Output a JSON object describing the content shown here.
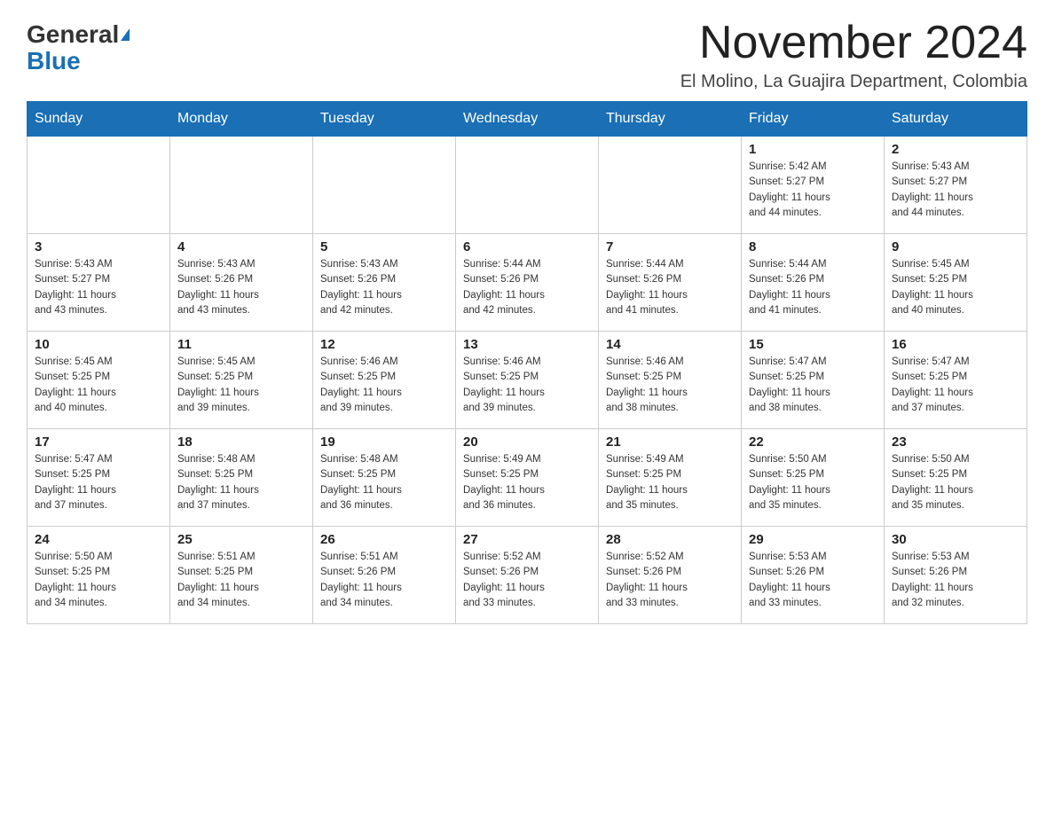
{
  "header": {
    "logo_general": "General",
    "logo_blue": "Blue",
    "month_title": "November 2024",
    "location": "El Molino, La Guajira Department, Colombia"
  },
  "weekdays": [
    "Sunday",
    "Monday",
    "Tuesday",
    "Wednesday",
    "Thursday",
    "Friday",
    "Saturday"
  ],
  "weeks": [
    [
      {
        "day": "",
        "info": ""
      },
      {
        "day": "",
        "info": ""
      },
      {
        "day": "",
        "info": ""
      },
      {
        "day": "",
        "info": ""
      },
      {
        "day": "",
        "info": ""
      },
      {
        "day": "1",
        "info": "Sunrise: 5:42 AM\nSunset: 5:27 PM\nDaylight: 11 hours\nand 44 minutes."
      },
      {
        "day": "2",
        "info": "Sunrise: 5:43 AM\nSunset: 5:27 PM\nDaylight: 11 hours\nand 44 minutes."
      }
    ],
    [
      {
        "day": "3",
        "info": "Sunrise: 5:43 AM\nSunset: 5:27 PM\nDaylight: 11 hours\nand 43 minutes."
      },
      {
        "day": "4",
        "info": "Sunrise: 5:43 AM\nSunset: 5:26 PM\nDaylight: 11 hours\nand 43 minutes."
      },
      {
        "day": "5",
        "info": "Sunrise: 5:43 AM\nSunset: 5:26 PM\nDaylight: 11 hours\nand 42 minutes."
      },
      {
        "day": "6",
        "info": "Sunrise: 5:44 AM\nSunset: 5:26 PM\nDaylight: 11 hours\nand 42 minutes."
      },
      {
        "day": "7",
        "info": "Sunrise: 5:44 AM\nSunset: 5:26 PM\nDaylight: 11 hours\nand 41 minutes."
      },
      {
        "day": "8",
        "info": "Sunrise: 5:44 AM\nSunset: 5:26 PM\nDaylight: 11 hours\nand 41 minutes."
      },
      {
        "day": "9",
        "info": "Sunrise: 5:45 AM\nSunset: 5:25 PM\nDaylight: 11 hours\nand 40 minutes."
      }
    ],
    [
      {
        "day": "10",
        "info": "Sunrise: 5:45 AM\nSunset: 5:25 PM\nDaylight: 11 hours\nand 40 minutes."
      },
      {
        "day": "11",
        "info": "Sunrise: 5:45 AM\nSunset: 5:25 PM\nDaylight: 11 hours\nand 39 minutes."
      },
      {
        "day": "12",
        "info": "Sunrise: 5:46 AM\nSunset: 5:25 PM\nDaylight: 11 hours\nand 39 minutes."
      },
      {
        "day": "13",
        "info": "Sunrise: 5:46 AM\nSunset: 5:25 PM\nDaylight: 11 hours\nand 39 minutes."
      },
      {
        "day": "14",
        "info": "Sunrise: 5:46 AM\nSunset: 5:25 PM\nDaylight: 11 hours\nand 38 minutes."
      },
      {
        "day": "15",
        "info": "Sunrise: 5:47 AM\nSunset: 5:25 PM\nDaylight: 11 hours\nand 38 minutes."
      },
      {
        "day": "16",
        "info": "Sunrise: 5:47 AM\nSunset: 5:25 PM\nDaylight: 11 hours\nand 37 minutes."
      }
    ],
    [
      {
        "day": "17",
        "info": "Sunrise: 5:47 AM\nSunset: 5:25 PM\nDaylight: 11 hours\nand 37 minutes."
      },
      {
        "day": "18",
        "info": "Sunrise: 5:48 AM\nSunset: 5:25 PM\nDaylight: 11 hours\nand 37 minutes."
      },
      {
        "day": "19",
        "info": "Sunrise: 5:48 AM\nSunset: 5:25 PM\nDaylight: 11 hours\nand 36 minutes."
      },
      {
        "day": "20",
        "info": "Sunrise: 5:49 AM\nSunset: 5:25 PM\nDaylight: 11 hours\nand 36 minutes."
      },
      {
        "day": "21",
        "info": "Sunrise: 5:49 AM\nSunset: 5:25 PM\nDaylight: 11 hours\nand 35 minutes."
      },
      {
        "day": "22",
        "info": "Sunrise: 5:50 AM\nSunset: 5:25 PM\nDaylight: 11 hours\nand 35 minutes."
      },
      {
        "day": "23",
        "info": "Sunrise: 5:50 AM\nSunset: 5:25 PM\nDaylight: 11 hours\nand 35 minutes."
      }
    ],
    [
      {
        "day": "24",
        "info": "Sunrise: 5:50 AM\nSunset: 5:25 PM\nDaylight: 11 hours\nand 34 minutes."
      },
      {
        "day": "25",
        "info": "Sunrise: 5:51 AM\nSunset: 5:25 PM\nDaylight: 11 hours\nand 34 minutes."
      },
      {
        "day": "26",
        "info": "Sunrise: 5:51 AM\nSunset: 5:26 PM\nDaylight: 11 hours\nand 34 minutes."
      },
      {
        "day": "27",
        "info": "Sunrise: 5:52 AM\nSunset: 5:26 PM\nDaylight: 11 hours\nand 33 minutes."
      },
      {
        "day": "28",
        "info": "Sunrise: 5:52 AM\nSunset: 5:26 PM\nDaylight: 11 hours\nand 33 minutes."
      },
      {
        "day": "29",
        "info": "Sunrise: 5:53 AM\nSunset: 5:26 PM\nDaylight: 11 hours\nand 33 minutes."
      },
      {
        "day": "30",
        "info": "Sunrise: 5:53 AM\nSunset: 5:26 PM\nDaylight: 11 hours\nand 32 minutes."
      }
    ]
  ]
}
